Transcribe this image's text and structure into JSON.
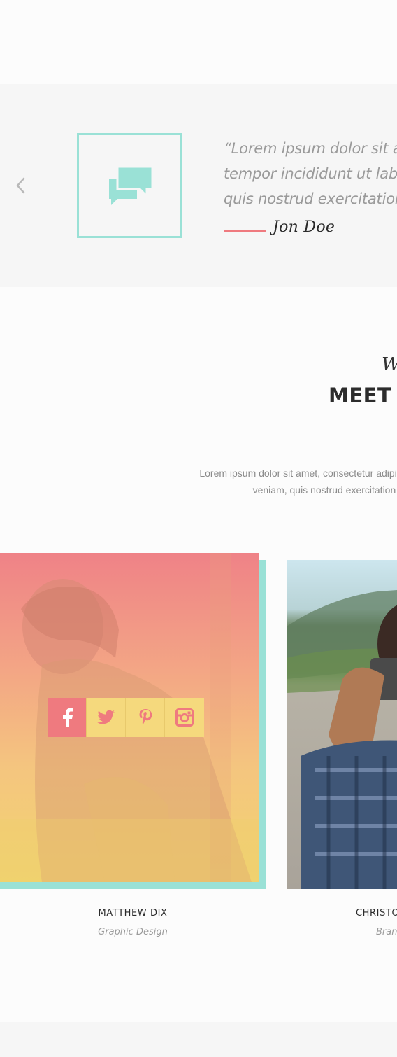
{
  "testimonial": {
    "prev_icon": "chevron-left-icon",
    "quote_icon": "chat-bubbles-icon",
    "quote_lines": [
      "“Lorem ipsum dolor sit am",
      "tempor incididunt ut labo",
      "quis nostrud exercitation."
    ],
    "author": "Jon Doe",
    "colors": {
      "accent_teal": "#9ae1d6",
      "accent_red": "#ef7a7f",
      "band_bg": "#f6f6f6"
    }
  },
  "team": {
    "eyebrow": "W",
    "title": "MEET O",
    "description_lines": [
      "Lorem ipsum dolor sit amet, consectetur adipiscing elit, sed do eiu",
      "veniam, quis nostrud exercitation ullamco"
    ],
    "members": [
      {
        "name": "MATTHEW DIX",
        "role": "Graphic Design",
        "social": [
          "facebook-icon",
          "twitter-icon",
          "pinterest-icon",
          "instagram-icon"
        ]
      },
      {
        "name": "CHRISTO",
        "role": "Brand"
      }
    ]
  }
}
